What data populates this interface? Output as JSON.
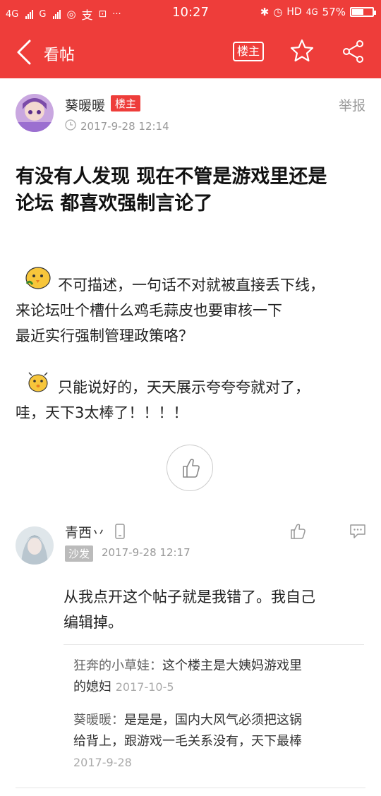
{
  "status_bar": {
    "signal_left": "4G",
    "signal_left_2": "G",
    "time": "10:27",
    "hd": "HD",
    "network": "4G",
    "battery": "57%",
    "battery_level": 0.57
  },
  "nav": {
    "title": "看帖",
    "louzhu_label": "楼主"
  },
  "post": {
    "author": "葵暖暖",
    "author_badge": "楼主",
    "time": "2017-9-28 12:14",
    "report_label": "举报",
    "title_line1": "有没有人发现 现在不管是游戏里还是",
    "title_line2": "论坛 都喜欢强制言论了",
    "para1_line1": "不可描述，一句话不对就被直接丢下线，",
    "para1_line2": "来论坛吐个槽什么鸡毛蒜皮也要审核一下",
    "para1_line3": "最近实行强制管理政策咯？",
    "para2_line1": "只能说好的，天天展示夸夸夸就对了，",
    "para2_line2": "哇，天下3太棒了！！！！"
  },
  "reply": {
    "name": "青西丷",
    "badge": "沙发",
    "time": "2017-9-28 12:17",
    "body_line1": "从我点开这个帖子就是我错了。我自己",
    "body_line2": "编辑掉。",
    "subreplies": [
      {
        "who": "狂奔的小草娃：",
        "text_line1": "这个楼主是大姨妈游戏里",
        "text_line2": "的媳妇",
        "time": "2017-10-5"
      },
      {
        "who": "葵暖暖：",
        "text_line1": "是是是，国内大风气必须把这锅",
        "text_line2": "给背上，跟游戏一毛关系没有，天下最棒",
        "time": "2017-9-28"
      }
    ]
  },
  "colors": {
    "brand": "#ee3d3a",
    "muted": "#999999"
  }
}
